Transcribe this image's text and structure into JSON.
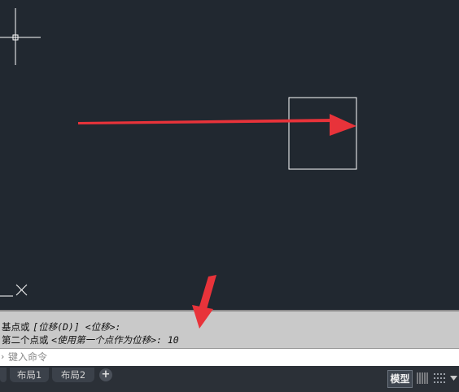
{
  "command_history": {
    "line1_prefix": "基点或 ",
    "line1_option": "[位移(D)]",
    "line1_suffix": " <位移>:",
    "line2_prefix": "第二个点或 ",
    "line2_option": "<使用第一个点作为位移>: 10"
  },
  "command_input": {
    "placeholder": "键入命令",
    "caret_glyph": "›"
  },
  "tabs": [
    {
      "label": ""
    },
    {
      "label": "布局1"
    },
    {
      "label": "布局2"
    },
    {
      "label": "+"
    }
  ],
  "status_bar": {
    "model_label": "模型"
  },
  "colors": {
    "canvas_bg": "#212830",
    "arrow": "#e8333a",
    "crosshair": "#ffffff"
  },
  "icons": [
    "crosshair-cursor",
    "ucs-icon",
    "annotation-arrow",
    "grid-icon",
    "snap-icon",
    "dropdown-icon"
  ]
}
